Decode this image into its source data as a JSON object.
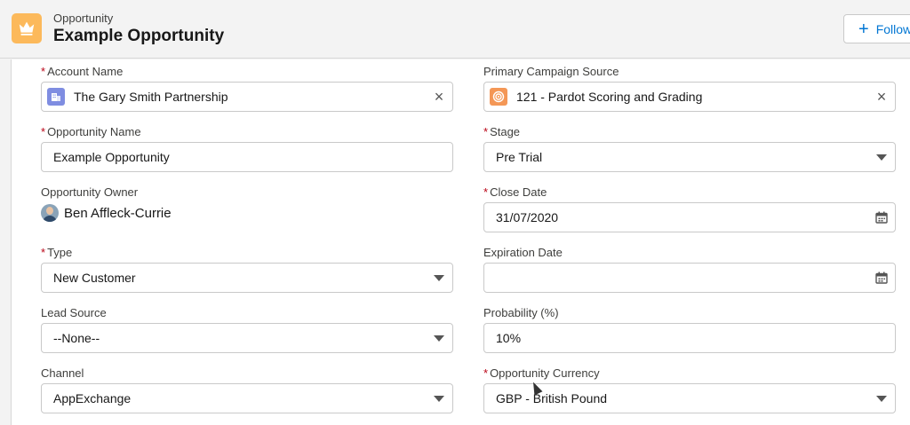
{
  "header": {
    "object_type": "Opportunity",
    "record_title": "Example Opportunity",
    "follow_label": "Follow",
    "icon": "crown-icon",
    "icon_color": "#fcb95b"
  },
  "fields": {
    "account_name": {
      "label": "Account Name",
      "required": "*",
      "value": "The Gary Smith Partnership",
      "icon": "account-icon",
      "icon_color": "#7f8de1"
    },
    "primary_campaign_source": {
      "label": "Primary Campaign Source",
      "value": "121 - Pardot Scoring and Grading",
      "icon": "campaign-icon",
      "icon_color": "#f49756"
    },
    "opportunity_name": {
      "label": "Opportunity Name",
      "required": "*",
      "value": "Example Opportunity"
    },
    "stage": {
      "label": "Stage",
      "required": "*",
      "value": "Pre Trial"
    },
    "opportunity_owner": {
      "label": "Opportunity Owner",
      "value": "Ben Affleck-Currie"
    },
    "close_date": {
      "label": "Close Date",
      "required": "*",
      "value": "31/07/2020"
    },
    "type": {
      "label": "Type",
      "required": "*",
      "value": "New Customer"
    },
    "expiration_date": {
      "label": "Expiration Date",
      "value": ""
    },
    "lead_source": {
      "label": "Lead Source",
      "value": "--None--"
    },
    "probability": {
      "label": "Probability (%)",
      "value": "10%"
    },
    "channel": {
      "label": "Channel",
      "value": "AppExchange"
    },
    "opportunity_currency": {
      "label": "Opportunity Currency",
      "required": "*",
      "value": "GBP - British Pound"
    }
  }
}
